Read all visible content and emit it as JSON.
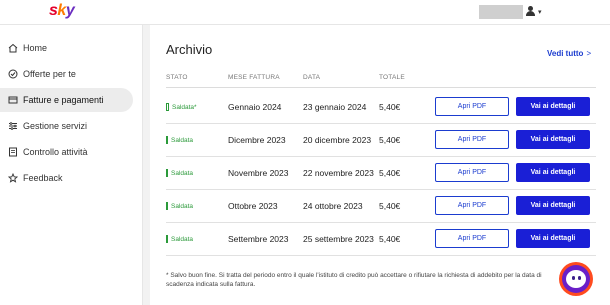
{
  "header": {
    "logo": {
      "s": "s",
      "k": "k",
      "y": "y"
    }
  },
  "sidebar": {
    "items": [
      {
        "label": "Home",
        "icon": "home-icon"
      },
      {
        "label": "Offerte per te",
        "icon": "offers-icon"
      },
      {
        "label": "Fatture e pagamenti",
        "icon": "invoice-icon",
        "active": true
      },
      {
        "label": "Gestione servizi",
        "icon": "services-icon"
      },
      {
        "label": "Controllo attività",
        "icon": "activity-icon"
      },
      {
        "label": "Feedback",
        "icon": "star-icon"
      }
    ]
  },
  "main": {
    "title": "Archivio",
    "see_all": "Vedi tutto",
    "see_all_arrow": ">",
    "columns": [
      "STATO",
      "MESE FATTURA",
      "DATA",
      "TOTALE"
    ],
    "rows": [
      {
        "status": "Saldata*",
        "month": "Gennaio 2024",
        "date": "23 gennaio 2024",
        "total": "5,40€",
        "pdf": "Apri PDF",
        "details": "Vai ai dettagli"
      },
      {
        "status": "Saldata",
        "month": "Dicembre 2023",
        "date": "20 dicembre 2023",
        "total": "5,40€",
        "pdf": "Apri PDF",
        "details": "Vai ai dettagli"
      },
      {
        "status": "Saldata",
        "month": "Novembre 2023",
        "date": "22 novembre 2023",
        "total": "5,40€",
        "pdf": "Apri PDF",
        "details": "Vai ai dettagli"
      },
      {
        "status": "Saldata",
        "month": "Ottobre 2023",
        "date": "24 ottobre 2023",
        "total": "5,40€",
        "pdf": "Apri PDF",
        "details": "Vai ai dettagli"
      },
      {
        "status": "Saldata",
        "month": "Settembre 2023",
        "date": "25 settembre 2023",
        "total": "5,40€",
        "pdf": "Apri PDF",
        "details": "Vai ai dettagli"
      }
    ],
    "footnote": "* Salvo buon fine. Si tratta del periodo entro il quale l'istituto di credito può accettare o rifiutare la richiesta di addebito per la data di scadenza indicata sulla fattura."
  },
  "colors": {
    "primary": "#1a1fd6",
    "link": "#1b3ccf",
    "status_paid": "#2b9a3a",
    "brand_red": "#e4002b",
    "brand_orange": "#ff7a00",
    "brand_purple": "#6a2cc0"
  }
}
